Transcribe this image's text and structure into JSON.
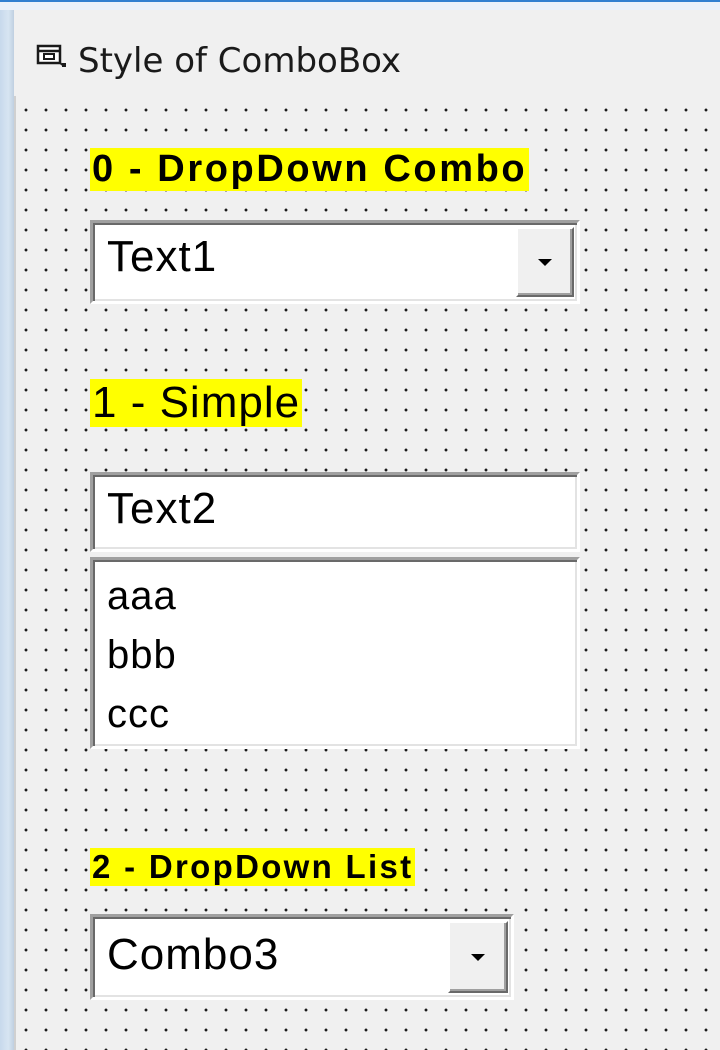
{
  "window": {
    "title": "Style of ComboBox",
    "icon": "form-icon"
  },
  "controls": {
    "combo0": {
      "label": "0 - DropDown Combo",
      "text": "Text1",
      "button_icon": "chevron-down-icon"
    },
    "combo1": {
      "label": "1 - Simple",
      "text": "Text2",
      "items": [
        "aaa",
        "bbb",
        "ccc"
      ]
    },
    "combo2": {
      "label": "2 - DropDown List",
      "text": "Combo3",
      "button_icon": "chevron-down-icon"
    }
  }
}
